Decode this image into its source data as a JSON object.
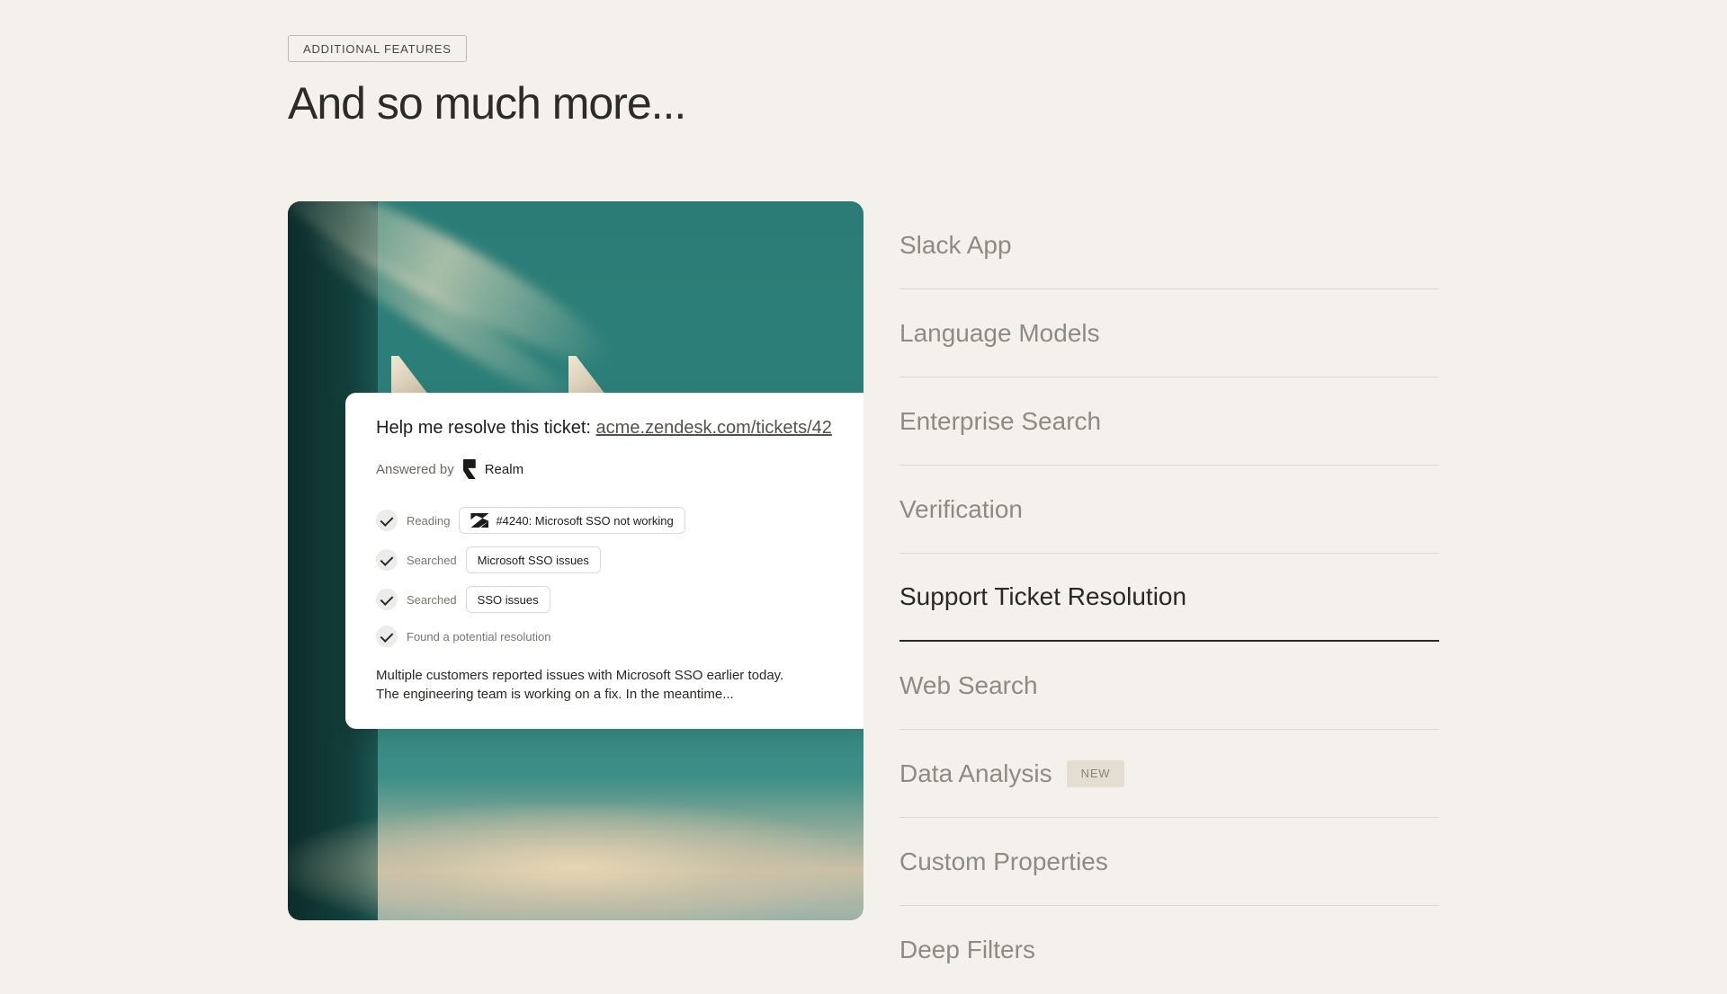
{
  "header": {
    "eyebrow": "ADDITIONAL FEATURES",
    "headline": "And so much more..."
  },
  "demo_card": {
    "prompt_text": "Help me resolve this ticket:",
    "prompt_link": "acme.zendesk.com/tickets/42",
    "answered_by_label": "Answered by",
    "answered_by_name": "Realm",
    "steps": [
      {
        "verb": "Reading",
        "chip": "#4240: Microsoft SSO not working",
        "icon": "zendesk-icon"
      },
      {
        "verb": "Searched",
        "chip": "Microsoft SSO issues"
      },
      {
        "verb": "Searched",
        "chip": "SSO issues"
      },
      {
        "verb": "Found a potential resolution"
      }
    ],
    "result_line1": "Multiple customers reported issues with Microsoft SSO earlier today.",
    "result_line2": "The engineering team is working on a fix. In the meantime..."
  },
  "features": [
    {
      "label": "Slack App"
    },
    {
      "label": "Language Models"
    },
    {
      "label": "Enterprise Search"
    },
    {
      "label": "Verification"
    },
    {
      "label": "Support Ticket Resolution",
      "active": true
    },
    {
      "label": "Web Search"
    },
    {
      "label": "Data Analysis",
      "badge": "NEW"
    },
    {
      "label": "Custom Properties"
    },
    {
      "label": "Deep Filters"
    }
  ],
  "colors": {
    "background": "#f4f1ec",
    "teal": "#2b7c76",
    "active_text": "#2b2824",
    "inactive_text": "#8f8a82"
  }
}
